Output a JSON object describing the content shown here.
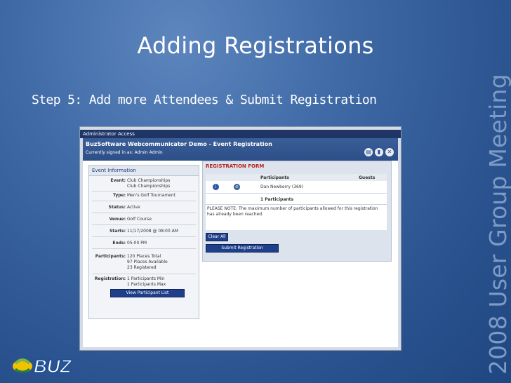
{
  "slide": {
    "title": "Adding Registrations",
    "step": "Step 5:  Add more Attendees & Submit Registration",
    "vertical_text": "2008 User Group Meeting",
    "logo_text": "BUZ"
  },
  "app": {
    "admin_bar": "Administrator Access",
    "title": "BuzSoftware Webcommunicator Demo - Event Registration",
    "signed_in": "Currently signed in as: Admin Admin"
  },
  "event_info": {
    "heading": "Event Information",
    "event_label": "Event:",
    "event_value": "Club Championships",
    "event_value2": "Club Championships",
    "type_label": "Type:",
    "type_value": "Men's Golf Tournament",
    "status_label": "Status:",
    "status_value": "Active",
    "venue_label": "Venue:",
    "venue_value": "Golf Course",
    "starts_label": "Starts:",
    "starts_value": "11/17/2008 @ 08:00 AM",
    "ends_label": "Ends:",
    "ends_value": "05:00 PM",
    "participants_label": "Participants:",
    "participants_1": "120 Places Total",
    "participants_2": "97 Places Available",
    "participants_3": "23 Registered",
    "registration_label": "Registration:",
    "registration_1": "1 Participants Min",
    "registration_2": "1 Participants Max",
    "view_list_button": "View Participant List"
  },
  "reg_form": {
    "heading": "REGISTRATION FORM",
    "col_participants": "Participants",
    "col_guests": "Guests",
    "participant_name": "Dan Newberry (369)",
    "count": "1 Participants",
    "note": "PLEASE NOTE: The maximum number of participants allowed for this registration has already been reached.",
    "clear_button": "Clear All",
    "submit_button": "Submit Registration"
  },
  "colors": {
    "accent": "#1f3f8a",
    "form_heading": "#b5241f"
  }
}
